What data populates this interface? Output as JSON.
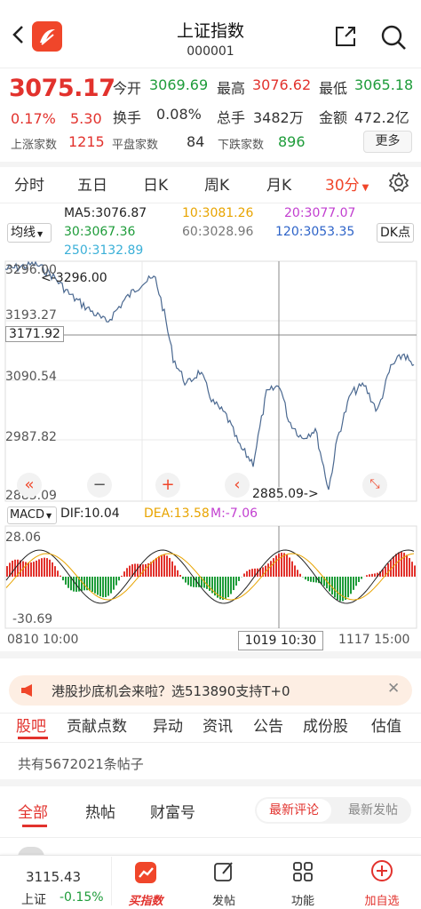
{
  "header": {
    "title": "上证指数",
    "code": "000001"
  },
  "quote": {
    "price": "3075.17",
    "change_pct": "0.17%",
    "change": "5.30",
    "open_label": "今开",
    "open": "3069.69",
    "high_label": "最高",
    "high": "3076.62",
    "low_label": "最低",
    "low": "3065.18",
    "turnover_label": "换手",
    "turnover": "0.08%",
    "volume_label": "总手",
    "volume": "3482万",
    "amount_label": "金额",
    "amount": "472.2亿",
    "up_label": "上涨家数",
    "up": "1215",
    "flat_label": "平盘家数",
    "flat": "84",
    "down_label": "下跌家数",
    "down": "896",
    "more_label": "更多"
  },
  "period_tabs": [
    "分时",
    "五日",
    "日K",
    "周K",
    "月K"
  ],
  "period_selected": "30分",
  "ma": {
    "mode": "均线",
    "ma5": "MA5:3076.87",
    "ma10": "10:3081.26",
    "ma20": "20:3077.07",
    "ma30": "30:3067.36",
    "ma60": "60:3028.96",
    "ma120": "120:3053.35",
    "ma250": "250:3132.89",
    "dk_label": "DK点"
  },
  "colors": {
    "ma5": "#222222",
    "ma10": "#e8a400",
    "ma20": "#c23fd0",
    "ma30": "#1e9c3a",
    "ma60": "#777777",
    "ma120": "#2d63c8",
    "ma250": "#3bb0d8",
    "up": "#e2322d",
    "down": "#1e9c3a",
    "accent": "#f0462a"
  },
  "chart": {
    "y_ticks": [
      "3296.00",
      "3193.27",
      "3090.54",
      "2987.82",
      "2885.09"
    ],
    "crosshair_value": "3171.92",
    "max_marker": "<-3296.00",
    "min_marker": "2885.09->",
    "x_start": "0810 10:00",
    "x_mid": "1019 10:30",
    "x_end": "1117 15:00"
  },
  "macd": {
    "mode": "MACD",
    "dif": "DIF:10.04",
    "dea": "DEA:13.58",
    "m": "M:-7.06",
    "top": "28.06",
    "bottom": "-30.69"
  },
  "banner": {
    "text": "港股抄底机会来啦？选513890支持T+0"
  },
  "content_tabs": [
    "股吧",
    "贡献点数",
    "异动",
    "资讯",
    "公告",
    "成份股",
    "估值"
  ],
  "post_count": "共有5672021条帖子",
  "filters": {
    "all": "全部",
    "hot": "热帖",
    "wealth": "财富号",
    "latest_comment": "最新评论",
    "latest_post": "最新发帖"
  },
  "footer": {
    "index_price": "3115.43",
    "index_name": "上证",
    "index_change": "-0.15%",
    "buy_label": "买指数",
    "post_label": "发帖",
    "feature_label": "功能",
    "add_label": "加自选"
  }
}
